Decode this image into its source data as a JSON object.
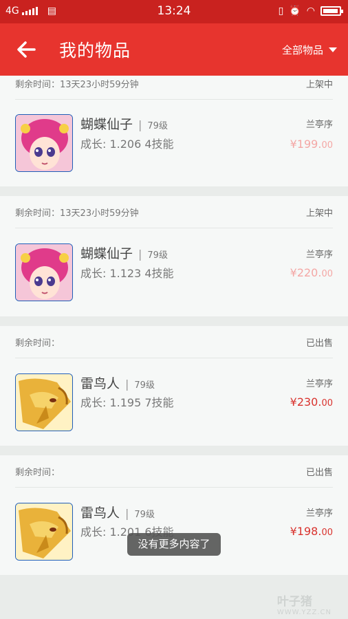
{
  "status_bar": {
    "network": "4G",
    "time": "13:24"
  },
  "header": {
    "title": "我的物品",
    "filter_label": "全部物品"
  },
  "items": [
    {
      "remaining_label": "剩余时间：13天23小时59分钟",
      "status": "上架中",
      "name": "蝴蝶仙子",
      "level": "79级",
      "growth": "成长: 1.206  4技能",
      "server": "兰亭序",
      "price_main": "¥199.",
      "price_decimal": "00",
      "price_color": "#f4a7a5",
      "avatar": "butterfly-fairy"
    },
    {
      "remaining_label": "剩余时间：13天23小时59分钟",
      "status": "上架中",
      "name": "蝴蝶仙子",
      "level": "79级",
      "growth": "成长: 1.123  4技能",
      "server": "兰亭序",
      "price_main": "¥220.",
      "price_decimal": "00",
      "price_color": "#f4a7a5",
      "avatar": "butterfly-fairy"
    },
    {
      "remaining_label": "剩余时间：",
      "status": "已出售",
      "name": "雷鸟人",
      "level": "79级",
      "growth": "成长: 1.195  7技能",
      "server": "兰亭序",
      "price_main": "¥230.",
      "price_decimal": "00",
      "price_color": "#d9332e",
      "avatar": "thunderbird-man"
    },
    {
      "remaining_label": "剩余时间：",
      "status": "已出售",
      "name": "雷鸟人",
      "level": "79级",
      "growth": "成长: 1.201  6技能",
      "server": "兰亭序",
      "price_main": "¥198.",
      "price_decimal": "00",
      "price_color": "#d9332e",
      "avatar": "thunderbird-man"
    }
  ],
  "toast": "没有更多内容了",
  "watermark": {
    "brand": "叶子猪",
    "url": "WWW.YZZ.CN"
  },
  "colors": {
    "status_bar": "#c9221f",
    "header": "#e7342e",
    "card_bg": "#f6f8f7",
    "page_bg": "#e9ecea"
  }
}
